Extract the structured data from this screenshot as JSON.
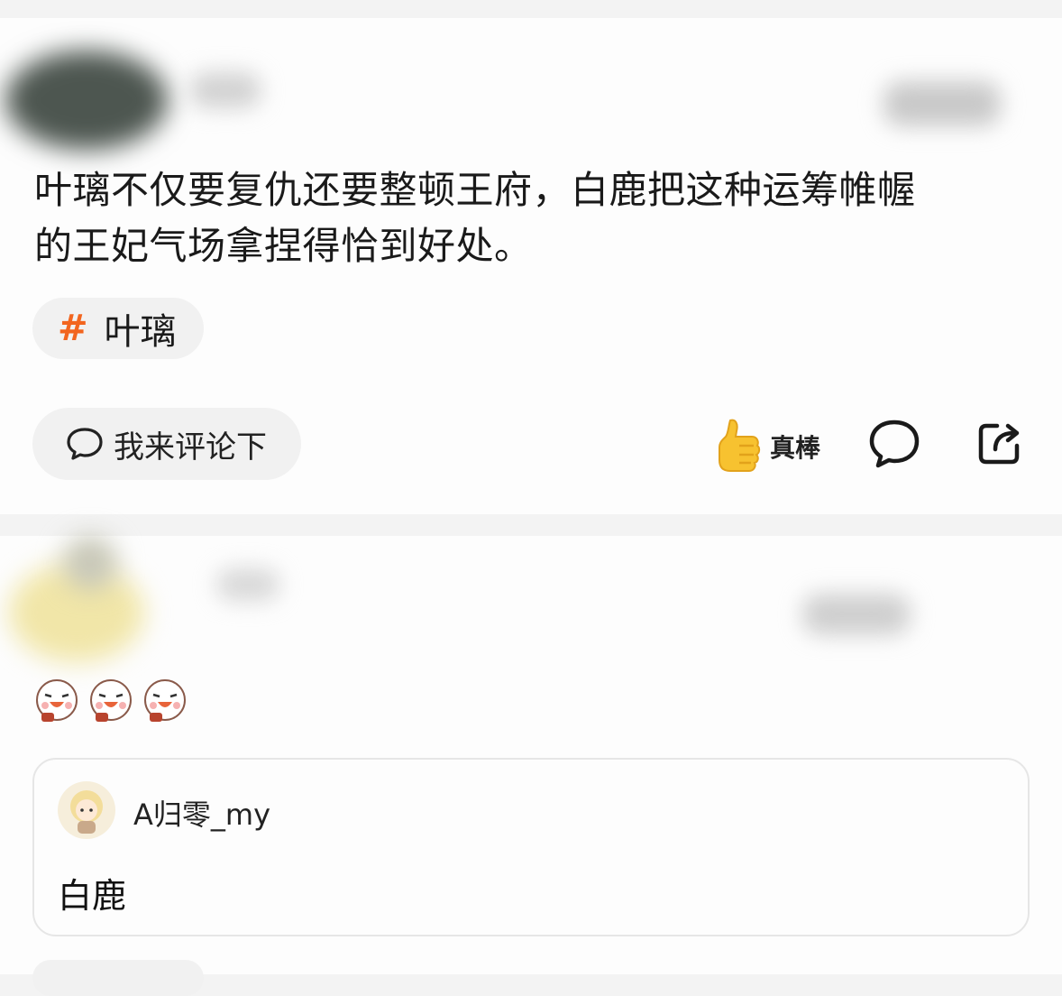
{
  "post": {
    "text_line1": "叶璃不仅要复仇还要整顿王府，白鹿把这种运筹帷幄",
    "text_line2": "的王妃气场拿捏得恰到好处。",
    "topic": {
      "hash": "#",
      "label": "叶璃",
      "hash_color": "#f2651f"
    },
    "actions": {
      "comment_placeholder": "我来评论下",
      "like_label": "真棒",
      "comment_icon": "speech-bubble-icon",
      "share_icon": "share-icon"
    }
  },
  "reply_post": {
    "emoji_count": 3,
    "quoted_reply": {
      "username": "A归零_my",
      "text": "白鹿"
    }
  }
}
